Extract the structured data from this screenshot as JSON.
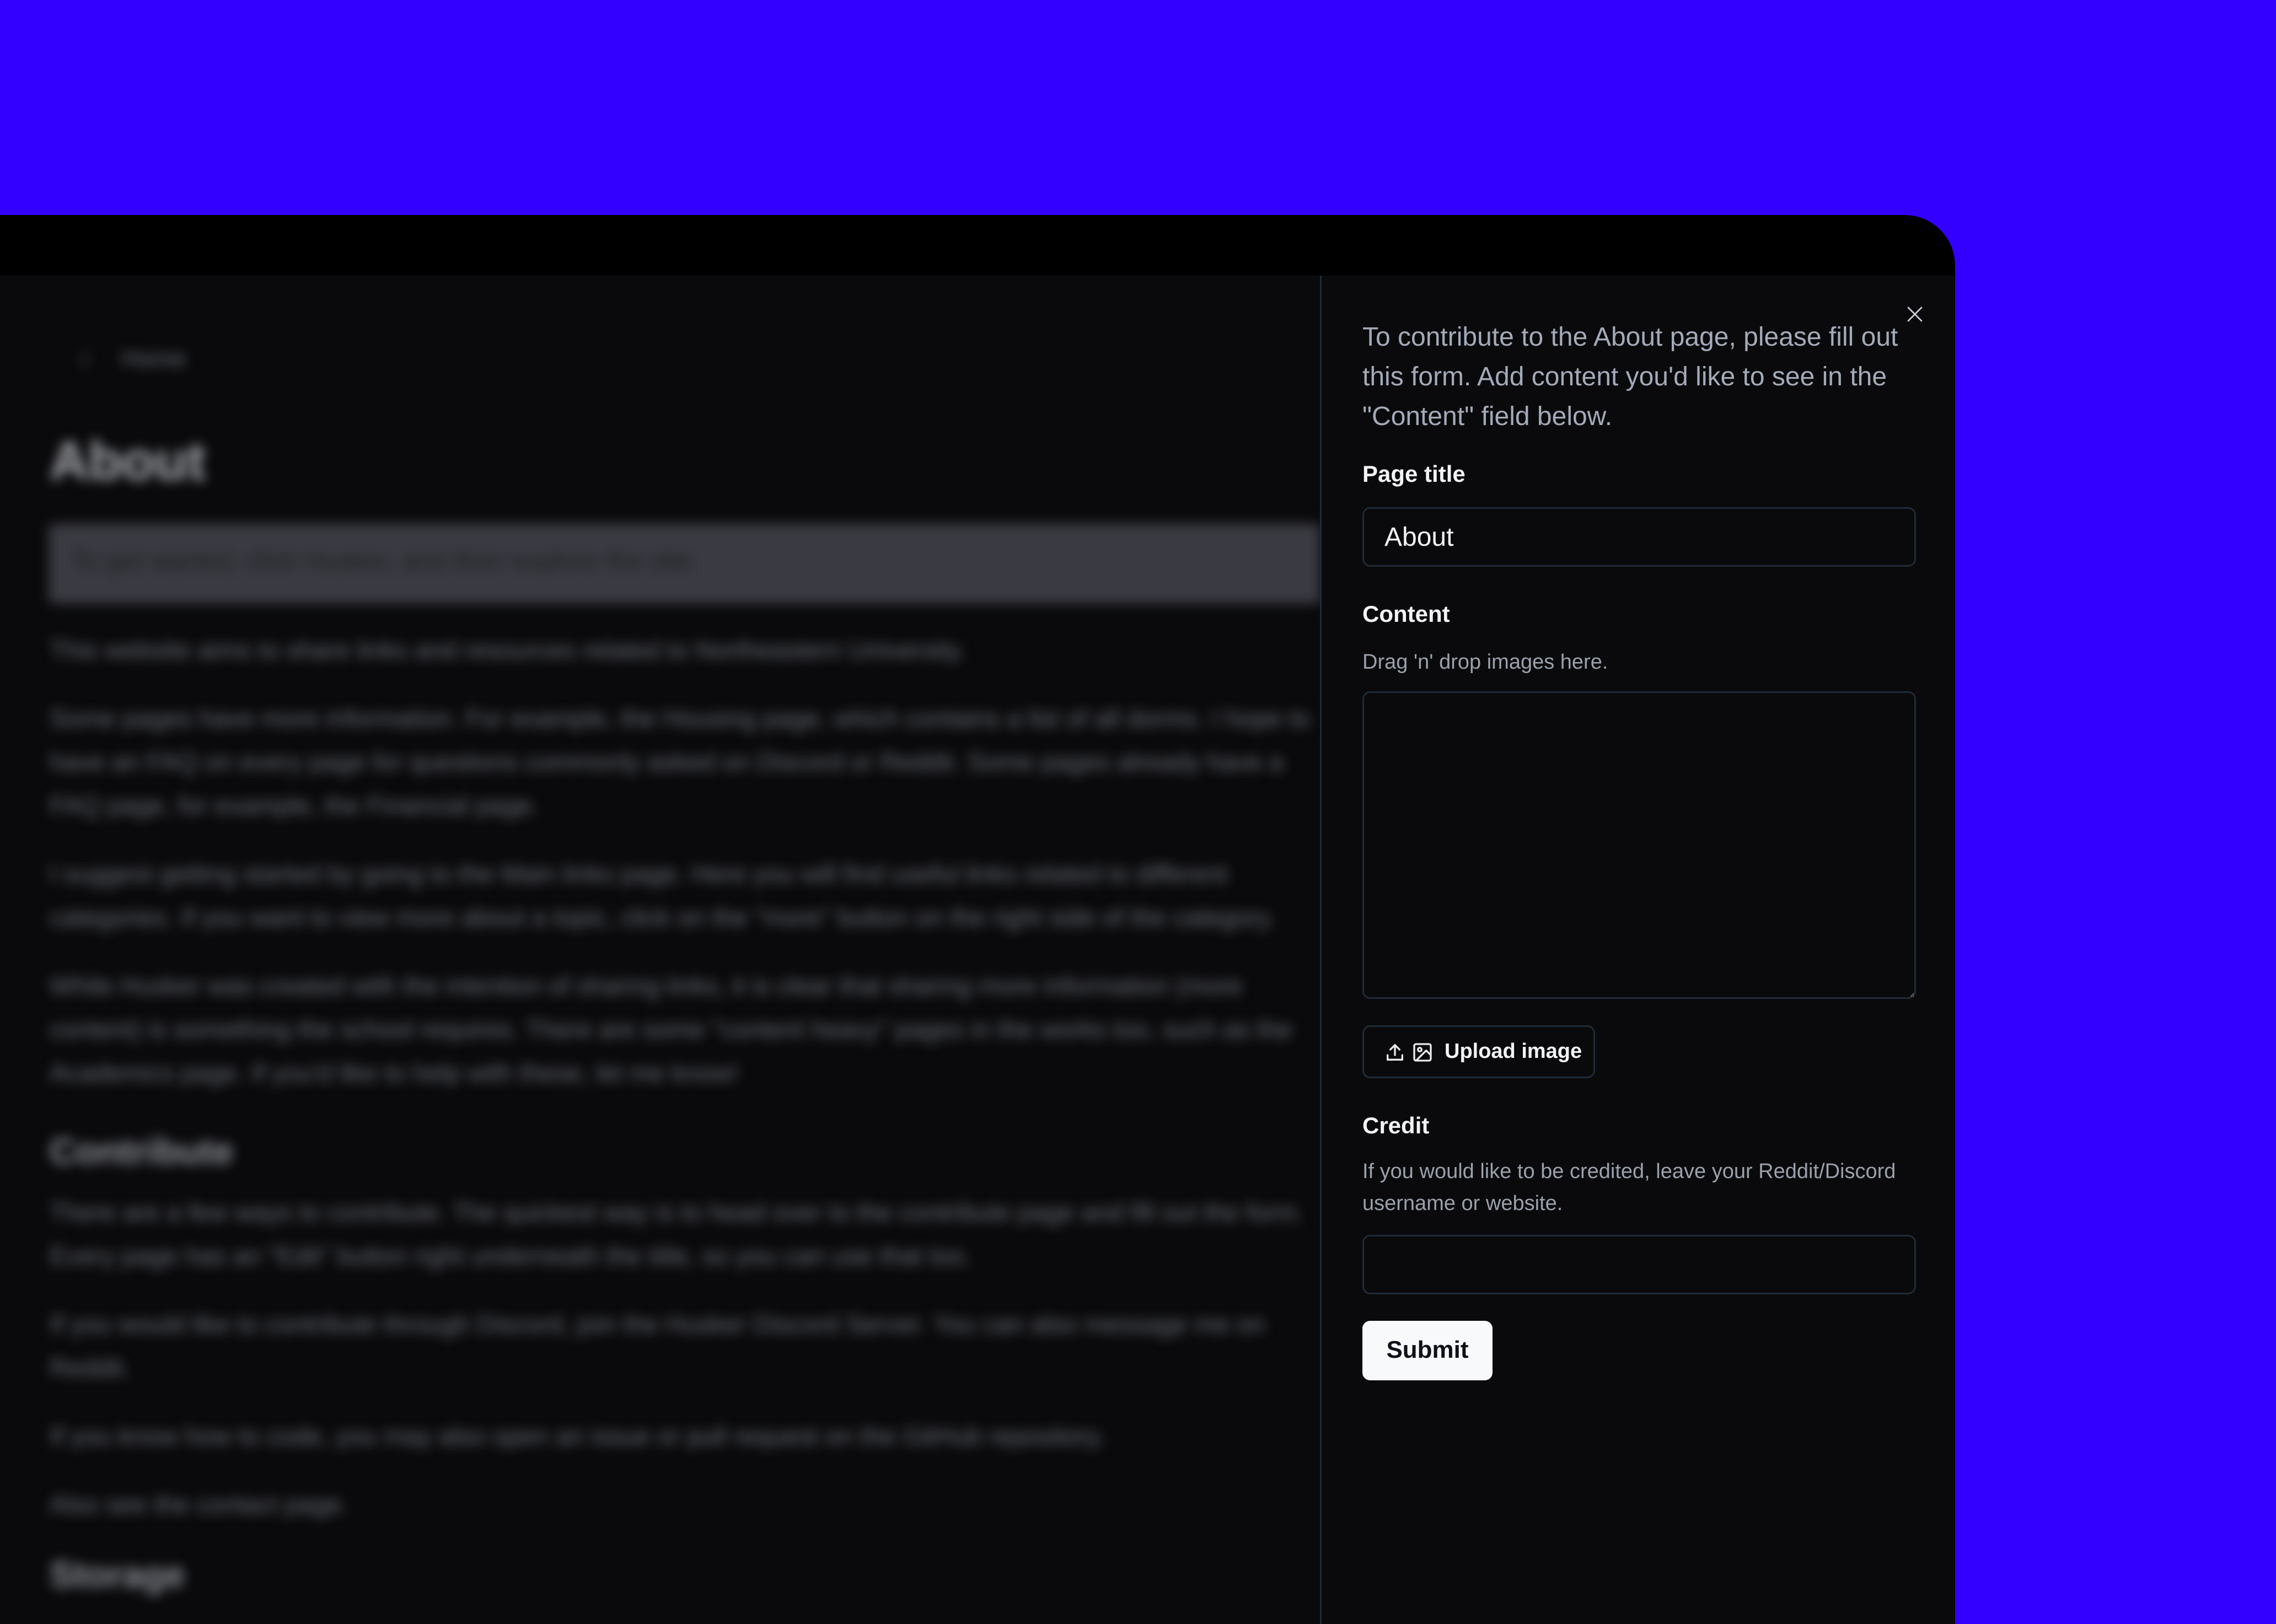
{
  "background": {
    "color": "#3300ff"
  },
  "page": {
    "breadcrumb": "Home",
    "title": "About",
    "banner": "To get started, click Husker, and then explore the site.",
    "paragraphs": [
      "This website aims to share links and resources related to Northeastern University.",
      "Some pages have more information. For example, the Housing page, which contains a list of all dorms. I hope to",
      "have an FAQ on every page for questions commonly asked on Discord or Reddit. Some pages already have a",
      "FAQ page, for example, the Financial page.",
      "I suggest getting started by going to the Main links page. Here you will find useful links related to different",
      "categories. If you want to view more about a topic, click on the \"more\" button on the right side of the category.",
      "While Husker was created with the intention of sharing links, it is clear that sharing more information (more",
      "content) is something the school requires. There are some \"content heavy\" pages in the works too, such as the",
      "Academics page. If you'd like to help with these, let me know!",
      "There are a few ways to contribute. The quickest way is to head over to the contribute page and fill out the form.",
      "Every page has an \"Edit\" button right underneath the title, so you can use that too.",
      "If you would like to contribute through Discord, join the Husker Discord Server. You can also message me on",
      "Reddit.",
      "If you know how to code, you may also open an issue or pull request on the GitHub repository.",
      "Also see the contact page."
    ],
    "section_contribute": "Contribute",
    "section_storage": "Storage"
  },
  "drawer": {
    "intro": "To contribute to the About page, please fill out this form. Add content you'd like to see in the \"Content\" field below.",
    "page_title_label": "Page title",
    "page_title_value": "About",
    "content_label": "Content",
    "content_hint": "Drag 'n' drop images here.",
    "content_value": "",
    "upload_label": "Upload image",
    "credit_label": "Credit",
    "credit_hint": "If you would like to be credited, leave your Reddit/Discord username or website.",
    "credit_value": "",
    "submit_label": "Submit"
  }
}
